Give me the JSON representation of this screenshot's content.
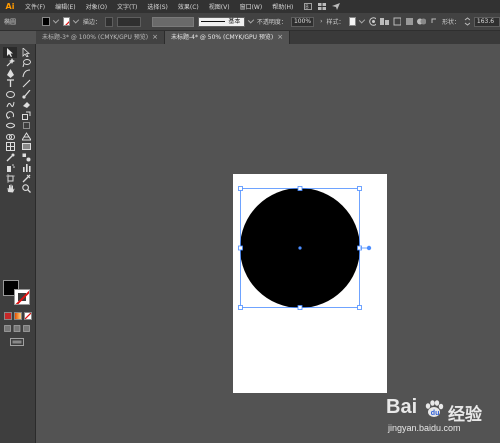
{
  "app": {
    "logo": "Ai"
  },
  "menu": {
    "items": [
      "文件(F)",
      "编辑(E)",
      "对象(O)",
      "文字(T)",
      "选择(S)",
      "效果(C)",
      "视图(V)",
      "窗口(W)",
      "帮助(H)"
    ]
  },
  "controlbar": {
    "selection_label": "椭圆",
    "stroke_label": "描边：",
    "brush_label": "基本",
    "opacity_label": "不透明度：",
    "opacity_value": "100%",
    "style_label": "样式：",
    "shape_label": "形状：",
    "shape_value": "163.6"
  },
  "tabs": [
    {
      "label": "未标题-3* @ 100% (CMYK/GPU 预览)",
      "active": false
    },
    {
      "label": "未标题-4* @ 50% (CMYK/GPU 预览)",
      "active": true
    }
  ],
  "tabs_close_glyph": "×",
  "colors": {
    "fill": "#000000",
    "stroke": "none",
    "selection": "#4b8dff",
    "accent_logo": "#ff9a00"
  },
  "watermark": {
    "brand": "Bai",
    "product": "经验",
    "url": "jingyan.baidu.com"
  }
}
